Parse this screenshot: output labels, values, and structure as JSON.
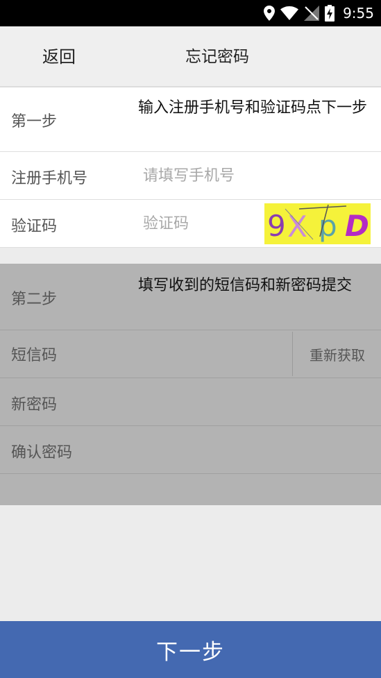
{
  "status": {
    "time": "9:55"
  },
  "header": {
    "back_label": "返回",
    "title": "忘记密码"
  },
  "step1": {
    "label": "第一步",
    "description": "输入注册手机号和验证码点下一步",
    "phone_label": "注册手机号",
    "phone_placeholder": "请填写手机号",
    "code_label": "验证码",
    "code_placeholder": "验证码",
    "captcha_text": "9XpD"
  },
  "step2": {
    "label": "第二步",
    "description": "填写收到的短信码和新密码提交",
    "sms_label": "短信码",
    "resend_label": "重新获取",
    "new_password_label": "新密码",
    "confirm_password_label": "确认密码"
  },
  "footer": {
    "next_label": "下一步"
  },
  "colors": {
    "primary": "#4469b1",
    "disabled_section": "#b3b3b3",
    "captcha_bg": "#f5f23a"
  }
}
